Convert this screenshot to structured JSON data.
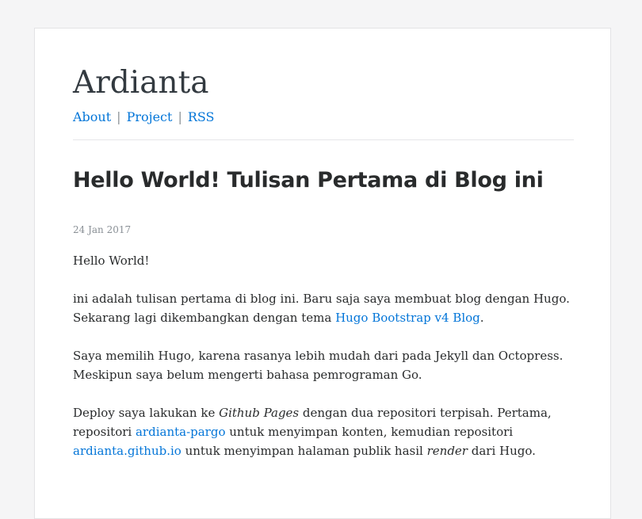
{
  "site": {
    "title": "Ardianta",
    "nav": [
      {
        "label": "About"
      },
      {
        "label": "Project"
      },
      {
        "label": "RSS"
      }
    ],
    "nav_separator": "|"
  },
  "post": {
    "title": "Hello World! Tulisan Pertama di Blog ini",
    "date": "24 Jan 2017",
    "p1": "Hello World!",
    "p2": {
      "before": "ini adalah tulisan pertama di blog ini. Baru saja saya membuat blog dengan Hugo. Sekarang lagi dikembangkan dengan tema ",
      "link": "Hugo Bootstrap v4 Blog",
      "after": "."
    },
    "p3": "Saya memilih Hugo, karena rasanya lebih mudah dari pada Jekyll dan Octopress. Meskipun saya belum mengerti bahasa pemrograman Go.",
    "p4": {
      "t1": "Deploy saya lakukan ke ",
      "em1": "Github Pages",
      "t2": " dengan dua repositori terpisah. Pertama, repositori ",
      "link1": "ardianta-pargo",
      "t3": " untuk menyimpan konten, kemudian repositori ",
      "link2": "ardianta.github.io",
      "t4": " untuk menyimpan halaman publik hasil ",
      "em2": "render",
      "t5": " dari Hugo."
    }
  },
  "colors": {
    "link": "#0275d8",
    "text": "#292b2c",
    "muted": "#8a9096",
    "background": "#f5f5f6",
    "card": "#ffffff"
  }
}
